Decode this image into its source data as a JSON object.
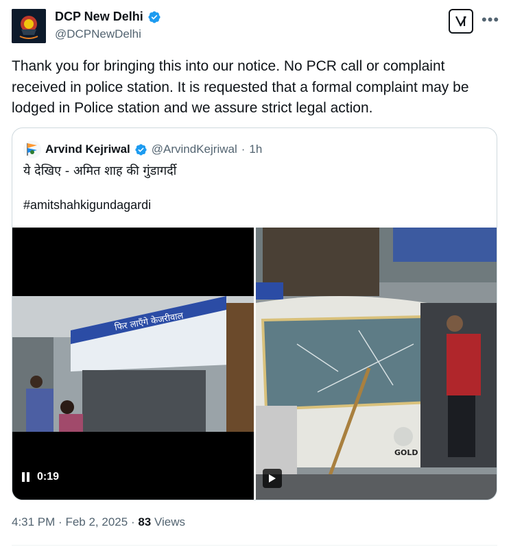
{
  "author": {
    "display_name": "DCP New Delhi",
    "handle": "@DCPNewDelhi",
    "verified": true,
    "verified_color": "#1d9bf0"
  },
  "post": {
    "text": "Thank you for bringing this into our notice. No PCR call or complaint received in police station. It is requested that a formal complaint may be lodged in Police station and we assure strict legal action."
  },
  "quoted_post": {
    "display_name": "Arvind Kejriwal",
    "handle": "@ArvindKejriwal",
    "separator": "·",
    "time": "1h",
    "text": "ये देखिए - अमित शाह की गुंडागर्दी",
    "hashtag": "#amitshahkigundagardi",
    "video_duration": "0:19",
    "banner_text": "फिर लाएँगे केजरीवाल",
    "vehicle_badge": "GOLD"
  },
  "meta": {
    "time": "4:31 PM",
    "sep1": "·",
    "date": "Feb 2, 2025",
    "sep2": "·",
    "views_count": "83",
    "views_label": "Views"
  },
  "icons": {
    "grok": "grok-icon",
    "more": "more-icon",
    "verified": "verified-icon",
    "pause": "pause-icon",
    "play": "play-icon"
  },
  "colors": {
    "text_primary": "#0f1419",
    "text_secondary": "#536471",
    "border": "#cfd9de"
  }
}
